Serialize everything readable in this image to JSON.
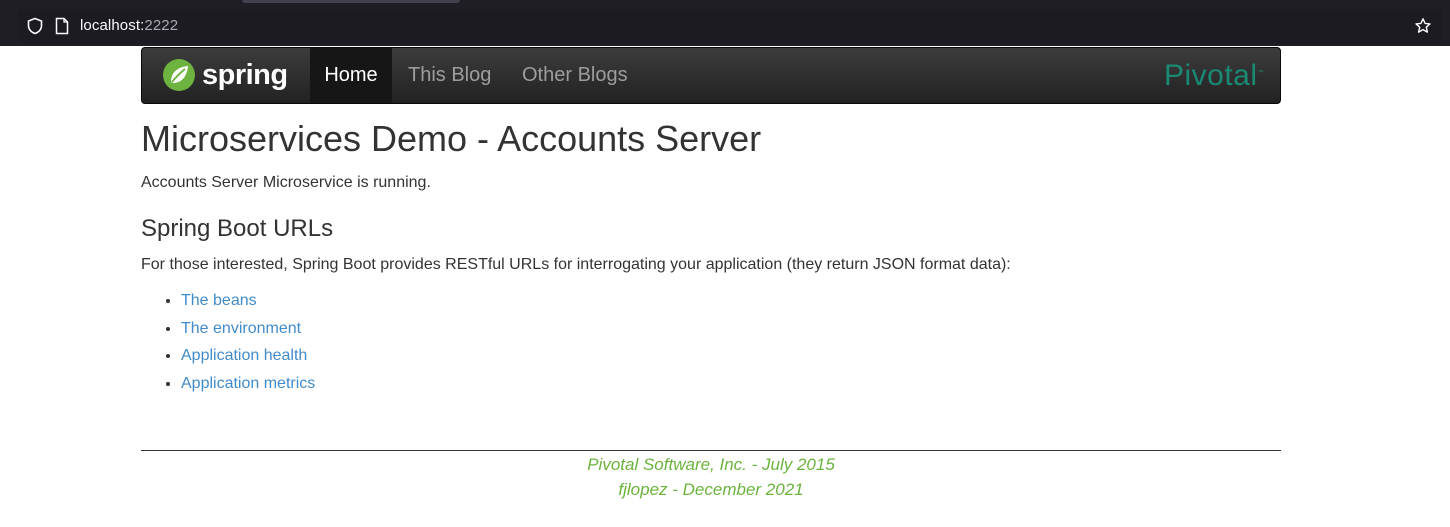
{
  "browser": {
    "url_host": "localhost:",
    "url_port": "2222"
  },
  "navbar": {
    "brand": "spring",
    "items": [
      {
        "label": "Home",
        "active": true
      },
      {
        "label": "This Blog",
        "active": false
      },
      {
        "label": "Other Blogs",
        "active": false
      }
    ],
    "partner_logo": "Pivotal",
    "partner_logo_mark": "™"
  },
  "main": {
    "title": "Microservices Demo - Accounts Server",
    "status": "Accounts Server Microservice is running.",
    "section_title": "Spring Boot URLs",
    "section_desc": "For those interested, Spring Boot provides RESTful URLs for interrogating your application (they return JSON format data):",
    "links": [
      "The beans",
      "The environment",
      "Application health",
      "Application metrics"
    ]
  },
  "footer": {
    "line1": "Pivotal Software, Inc. - July 2015",
    "line2": "fjlopez - December 2021"
  },
  "colors": {
    "navbar_bg": "#222222",
    "link": "#428bca",
    "footer_text": "#6cb33e",
    "pivotal_green": "#1a8a73",
    "spring_green": "#6db33f"
  }
}
